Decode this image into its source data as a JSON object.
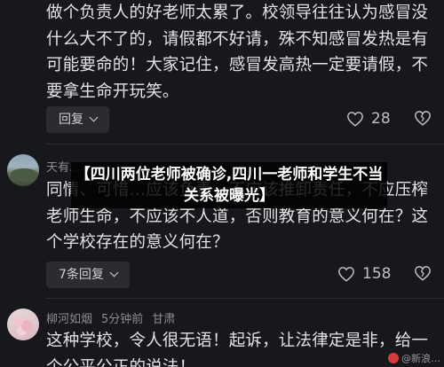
{
  "headline": "【四川两位老师被确诊,四川一老师和学生不当关系被曝光】",
  "comments": [
    {
      "text": "做个负责人的好老师太累了。校领导往往认为感冒没什么大不了的，请假都不好请，殊不知感冒发热是有可能要命的！大家记住，感冒发高热一定要请假，不要拿生命开玩笑。",
      "reply_label": "回复",
      "likes": "28"
    },
    {
      "author": "天有…",
      "text": "同情、可惜…应该负责，不应该推卸责任，不应压榨老师生命，不应该不人道，否则教育的意义何在？这个学校存在的意义何在？",
      "reply_label": "7条回复",
      "likes": "158"
    },
    {
      "author": "柳河如烟",
      "time": "5分钟前",
      "location": "甘肃",
      "text": "这种学校，令人很无语！起诉，让法律定是非，给一个公平公正的说法！"
    }
  ],
  "watermark": "@新浪…",
  "icons": {
    "like": "heart-icon",
    "dislike": "broken-heart-icon",
    "reply_expand": "chevron-down-icon"
  },
  "colors": {
    "background": "#17181b",
    "text": "#e3e3e5",
    "meta": "#8c8d92",
    "pill": "#2b2c30"
  }
}
